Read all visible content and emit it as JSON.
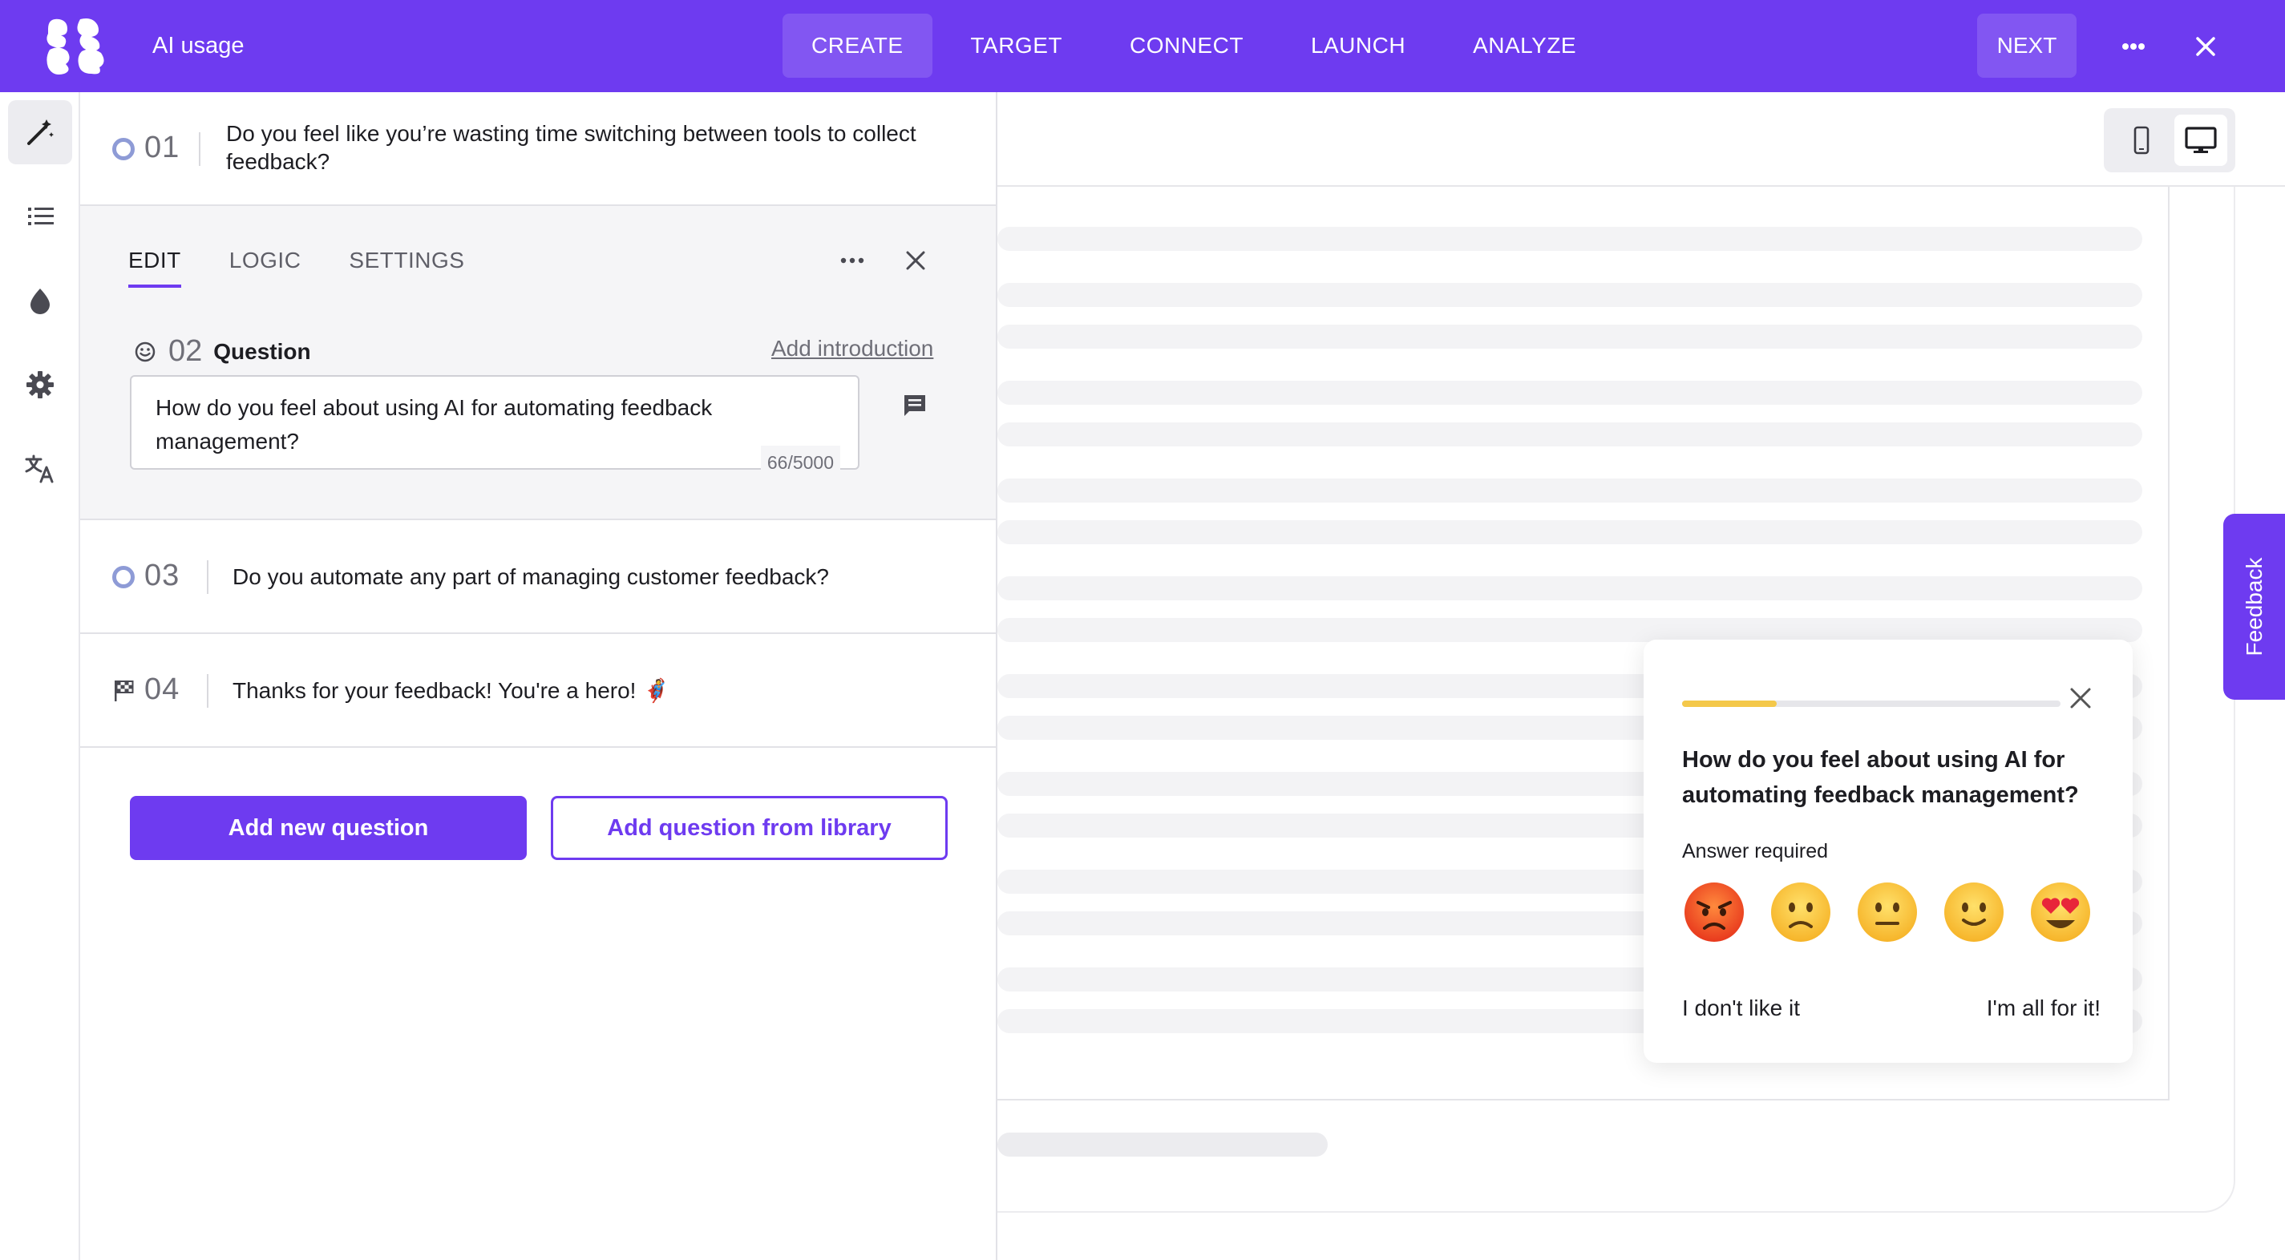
{
  "theme": {
    "brand": "#6e3bf0"
  },
  "header": {
    "title": "AI usage",
    "steps": [
      "CREATE",
      "TARGET",
      "CONNECT",
      "LAUNCH",
      "ANALYZE"
    ],
    "active_step": "CREATE",
    "next_label": "NEXT"
  },
  "rail": {
    "items": [
      "magic-wand-icon",
      "list-icon",
      "drop-icon",
      "gear-icon",
      "translate-icon"
    ]
  },
  "questions": [
    {
      "number": "01",
      "text": "Do you feel like you’re wasting time switching between tools to collect feedback?"
    },
    {
      "number": "03",
      "text": "Do you automate any part of managing customer feedback?"
    },
    {
      "number": "04",
      "text": "Thanks for your feedback! You're a hero! 🦸"
    }
  ],
  "editor": {
    "tabs": [
      "EDIT",
      "LOGIC",
      "SETTINGS"
    ],
    "active_tab": "EDIT",
    "question_number": "02",
    "question_label": "Question",
    "add_intro": "Add introduction",
    "question_text": "How do you feel about using AI for automating feedback management?",
    "char_count": "66/5000"
  },
  "actions": {
    "add_new": "Add new question",
    "add_library": "Add question from library"
  },
  "preview": {
    "feedback_tab": "Feedback",
    "widget": {
      "progress": 0.25,
      "question": "How do you feel about using AI for automating feedback management?",
      "required": "Answer required",
      "emojis": [
        "angry-emoji",
        "slightly-frowning-emoji",
        "neutral-emoji",
        "slightly-smiling-emoji",
        "heart-eyes-emoji"
      ],
      "min_label": "I don't like it",
      "max_label": "I'm all for it!"
    }
  }
}
